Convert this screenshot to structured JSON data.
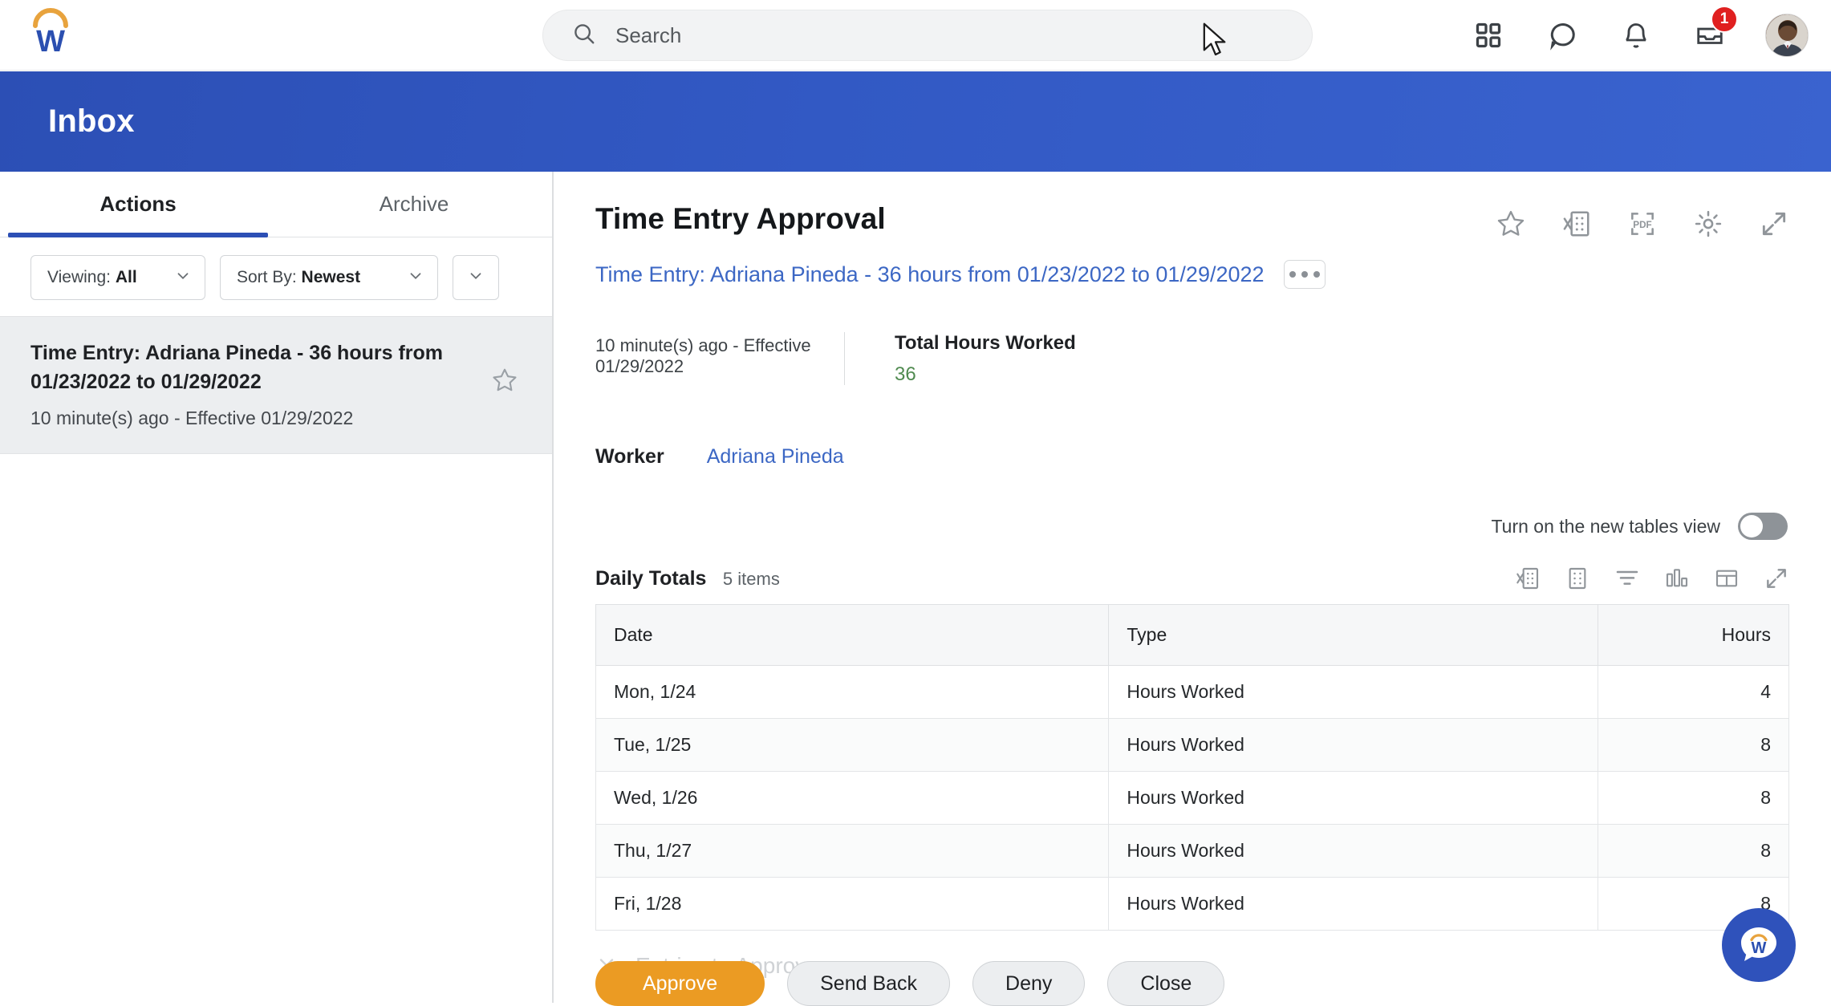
{
  "topbar": {
    "logo_alt": "Workday",
    "search": {
      "placeholder": "Search",
      "value": ""
    },
    "icons": [
      {
        "name": "apps-grid-icon",
        "label": "Apps"
      },
      {
        "name": "chat-bubble-icon",
        "label": "Chat"
      },
      {
        "name": "bell-icon",
        "label": "Notifications"
      },
      {
        "name": "inbox-tray-icon",
        "label": "Inbox"
      }
    ],
    "inbox_badge_count": "1",
    "avatar_label": "Profile"
  },
  "banner": {
    "title": "Inbox",
    "color": "#2c4fb5"
  },
  "sidebar": {
    "tabs": [
      {
        "label": "Actions",
        "active": true
      },
      {
        "label": "Archive",
        "active": false
      }
    ],
    "filters": {
      "viewing_prefix": "Viewing:",
      "viewing_value": "All",
      "sort_prefix": "Sort By:",
      "sort_value": "Newest",
      "more_label": ""
    },
    "items": [
      {
        "title": "Time Entry: Adriana Pineda - 36 hours from 01/23/2022 to 01/29/2022",
        "subtitle": "10 minute(s) ago - Effective 01/29/2022",
        "selected": true
      }
    ]
  },
  "main": {
    "title": "Time Entry Approval",
    "subtitle_link": "Time Entry: Adriana Pineda - 36 hours from 01/23/2022 to 01/29/2022",
    "overflow_label": "",
    "tools": [
      {
        "name": "star-icon",
        "label": "Favorite"
      },
      {
        "name": "excel-export-icon",
        "label": "Export to Excel"
      },
      {
        "name": "pdf-export-icon",
        "label": "Export to PDF"
      },
      {
        "name": "gear-icon",
        "label": "Settings"
      },
      {
        "name": "expand-icon",
        "label": "View Full Screen"
      }
    ],
    "meta": {
      "timestamp": "10 minute(s) ago -  Effective 01/29/2022",
      "total_label": "Total Hours Worked",
      "total_value": "36",
      "total_color": "#4f8a4f"
    },
    "worker": {
      "label": "Worker",
      "value": "Adriana Pineda"
    },
    "tables_toggle": {
      "label": "Turn on the new tables view",
      "on": false
    },
    "daily_totals": {
      "title": "Daily Totals",
      "count": "5 items",
      "tools": [
        {
          "name": "excel-export-icon",
          "label": "Export to Excel"
        },
        {
          "name": "grid-view-icon",
          "label": "Grid View"
        },
        {
          "name": "filter-icon",
          "label": "Filter"
        },
        {
          "name": "chart-icon",
          "label": "Chart View"
        },
        {
          "name": "column-config-icon",
          "label": "Configure Columns"
        },
        {
          "name": "expand-icon",
          "label": "Expand Table"
        }
      ],
      "columns": [
        "Date",
        "Type",
        "Hours"
      ],
      "rows": [
        {
          "date": "Mon, 1/24",
          "type": "Hours Worked",
          "hours": "4"
        },
        {
          "date": "Tue, 1/25",
          "type": "Hours Worked",
          "hours": "8"
        },
        {
          "date": "Wed, 1/26",
          "type": "Hours Worked",
          "hours": "8"
        },
        {
          "date": "Thu, 1/27",
          "type": "Hours Worked",
          "hours": "8"
        },
        {
          "date": "Fri, 1/28",
          "type": "Hours Worked",
          "hours": "8"
        }
      ]
    },
    "entries_section_label": "Entries to Approve",
    "buttons": [
      {
        "label": "Approve",
        "primary": true
      },
      {
        "label": "Send Back",
        "primary": false
      },
      {
        "label": "Deny",
        "primary": false
      },
      {
        "label": "Close",
        "primary": false
      }
    ]
  },
  "chat_fab": {
    "label": "Workday Assistant"
  }
}
